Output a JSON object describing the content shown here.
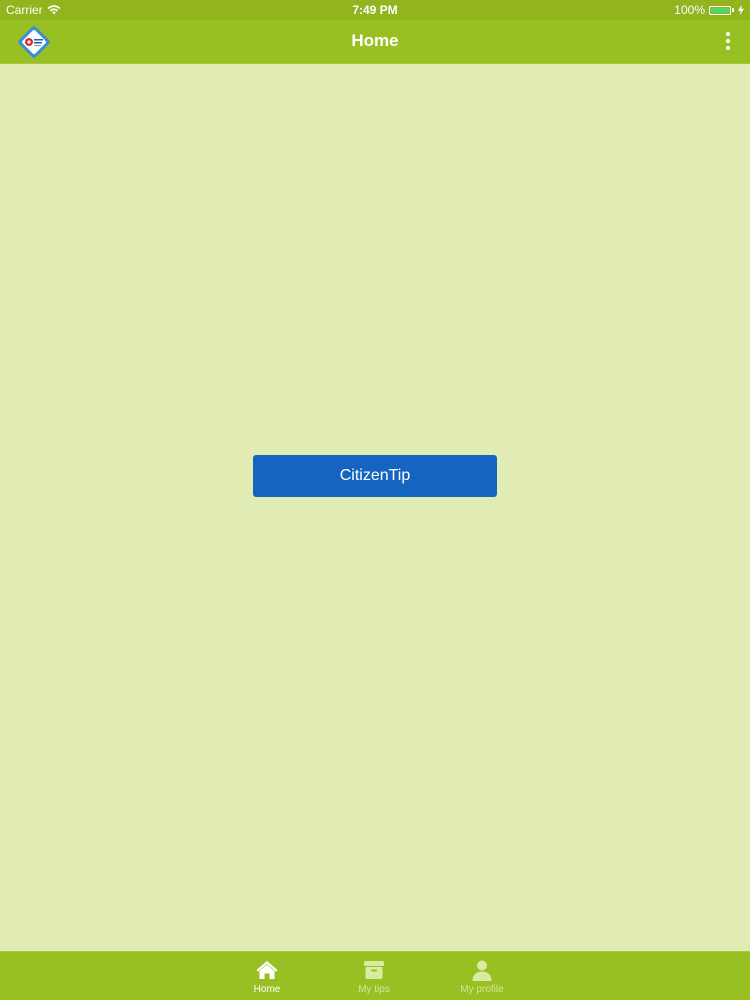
{
  "status_bar": {
    "carrier": "Carrier",
    "time": "7:49 PM",
    "battery_percent": "100%",
    "battery_level": 1.0,
    "wifi_icon": "wifi-icon",
    "charging_icon": "bolt-icon"
  },
  "nav": {
    "title": "Home",
    "logo_icon": "app-logo-icon",
    "menu_icon": "more-vertical-icon"
  },
  "main": {
    "citizentip_label": "CitizenTip"
  },
  "tabs": [
    {
      "label": "Home",
      "icon": "home-icon",
      "active": true
    },
    {
      "label": "My tips",
      "icon": "archive-box-icon",
      "active": false
    },
    {
      "label": "My profile",
      "icon": "user-icon",
      "active": false
    }
  ],
  "colors": {
    "primary_green": "#98c023",
    "background": "#e0ecb4",
    "button_blue": "#1565c0",
    "battery_green": "#4cd964"
  }
}
